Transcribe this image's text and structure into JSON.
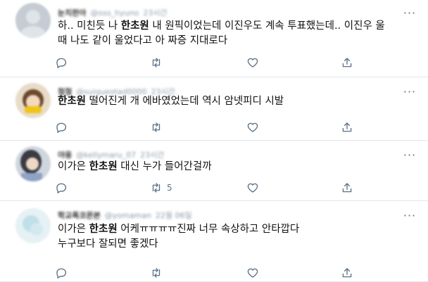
{
  "tweets": [
    {
      "author": {
        "name": "눈치판아",
        "handle": "@oss_hyuno",
        "time": "23시간"
      },
      "segments": [
        {
          "text": "하.. 미친듯 나 "
        },
        {
          "text": "한초원",
          "bold": true
        },
        {
          "text": " 내 원픽이었는데 이진우도 계속 투표했는데.. 이진우 울\n때 나도 같이 울었다고 아 짜증 지대로다"
        }
      ],
      "actions": {
        "reply_count": "",
        "retweet_count": "",
        "like_count": ""
      }
    },
    {
      "author": {
        "name": "첨첨",
        "handle": "@suiqueotad0000",
        "time": "23시간"
      },
      "segments": [
        {
          "text": "한초원",
          "bold": true
        },
        {
          "text": " 떨어진게 개 에바였었는데 역시 암넷피디 시발"
        }
      ],
      "actions": {
        "reply_count": "",
        "retweet_count": "",
        "like_count": ""
      }
    },
    {
      "author": {
        "name": "야옹",
        "handle": "@kellymaru_07",
        "time": "23시간"
      },
      "segments": [
        {
          "text": "이가은 "
        },
        {
          "text": "한초원",
          "bold": true
        },
        {
          "text": " 대신 누가 들어간걸까"
        }
      ],
      "actions": {
        "reply_count": "",
        "retweet_count": "5",
        "like_count": ""
      }
    },
    {
      "author": {
        "name": "학교폭코몬본",
        "handle": "@yomaman",
        "time": "22월 06일"
      },
      "segments": [
        {
          "text": "이가은 "
        },
        {
          "text": "한초원",
          "bold": true
        },
        {
          "text": " 어케ㅠㅠㅠㅠ진짜 너무 속상하고 안타깝다\n누구보다 잘되면 좋겠다"
        }
      ],
      "actions": {
        "reply_count": "",
        "retweet_count": "",
        "like_count": ""
      }
    }
  ],
  "icons": {
    "reply": "reply-icon",
    "retweet": "retweet-icon",
    "like": "heart-icon",
    "share": "share-icon",
    "more": "more-icon"
  },
  "colors": {
    "icon": "#5b7083",
    "divider": "#e1e8ed",
    "text": "#111111"
  }
}
